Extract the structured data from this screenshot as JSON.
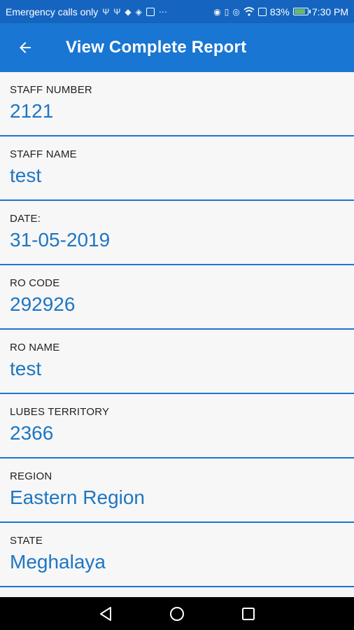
{
  "status_bar": {
    "carrier_text": "Emergency calls only",
    "battery_percent": "83%",
    "time": "7:30 PM",
    "left_icons": [
      "usb-icon",
      "usb-icon",
      "location-icon",
      "diamond-icon",
      "app-icon",
      "more-icon"
    ],
    "right_icons": [
      "location-pin-icon",
      "vibrate-icon",
      "eye-icon",
      "wifi-icon",
      "sim-icon",
      "battery-icon"
    ],
    "colors": {
      "background": "#1565c0"
    }
  },
  "app_bar": {
    "title": "View Complete Report",
    "back_icon": "arrow-back-icon",
    "colors": {
      "background": "#1976d2"
    }
  },
  "fields": [
    {
      "label": "STAFF NUMBER",
      "value": "2121"
    },
    {
      "label": "STAFF NAME",
      "value": "test"
    },
    {
      "label": "DATE:",
      "value": "31-05-2019"
    },
    {
      "label": "RO CODE",
      "value": "292926"
    },
    {
      "label": "RO NAME",
      "value": "test"
    },
    {
      "label": "LUBES TERRITORY",
      "value": "2366"
    },
    {
      "label": "REGION",
      "value": "Eastern Region"
    },
    {
      "label": "STATE",
      "value": "Meghalaya"
    }
  ],
  "colors": {
    "value_text": "#1e76c3",
    "divider": "#1976d2"
  },
  "nav_bar": {
    "buttons": [
      "back-triangle-icon",
      "home-circle-icon",
      "recents-square-icon"
    ]
  }
}
